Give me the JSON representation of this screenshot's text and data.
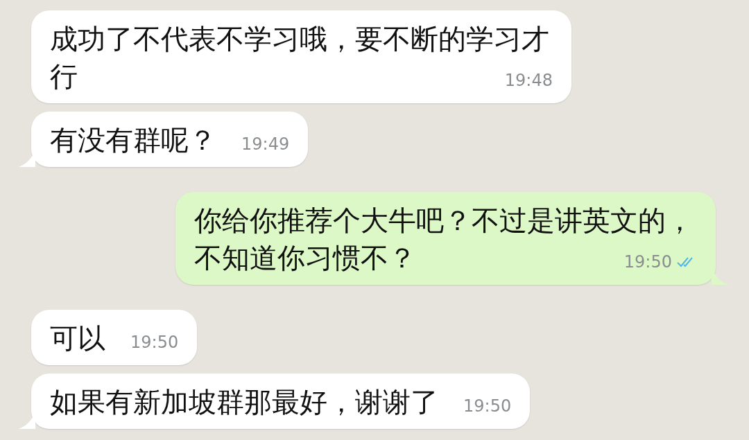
{
  "messages": [
    {
      "outgoing": false,
      "text": "成功了不代表不学习哦，要不断的学习才行",
      "time": "19:48",
      "tail": false
    },
    {
      "outgoing": false,
      "text": "有没有群呢？",
      "time": "19:49",
      "tail": true
    },
    {
      "outgoing": true,
      "text": "你给你推荐个大牛吧？不过是讲英文的，不知道你习惯不？",
      "time": "19:50",
      "tail": true,
      "read": true
    },
    {
      "outgoing": false,
      "text": "可以",
      "time": "19:50",
      "tail": false
    },
    {
      "outgoing": false,
      "text": "如果有新加坡群那最好，谢谢了",
      "time": "19:50",
      "tail": true
    }
  ]
}
